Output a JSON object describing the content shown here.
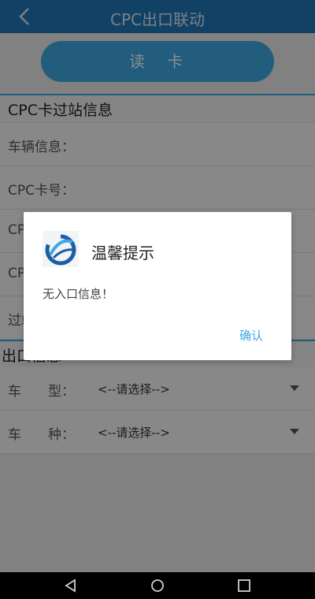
{
  "header": {
    "title": "CPC出口联动"
  },
  "read_button": {
    "label": "读　卡"
  },
  "cpc_section": {
    "title": "CPC卡过站信息",
    "rows": [
      {
        "label": "车辆信息："
      },
      {
        "label": "CPC卡号："
      },
      {
        "label": "CPC"
      },
      {
        "label": "CPC"
      },
      {
        "label": "过站"
      }
    ]
  },
  "exit_section": {
    "title": "出口信息",
    "rows": [
      {
        "label": "车　　型：",
        "value": "<--请选择-->"
      },
      {
        "label": "车　　种：",
        "value": "<--请选择-->"
      }
    ]
  },
  "dialog": {
    "title": "温馨提示",
    "message": "无入口信息！",
    "confirm": "确认"
  },
  "colors": {
    "appbar": "#1f78bb",
    "accent": "#3fa9e4"
  }
}
